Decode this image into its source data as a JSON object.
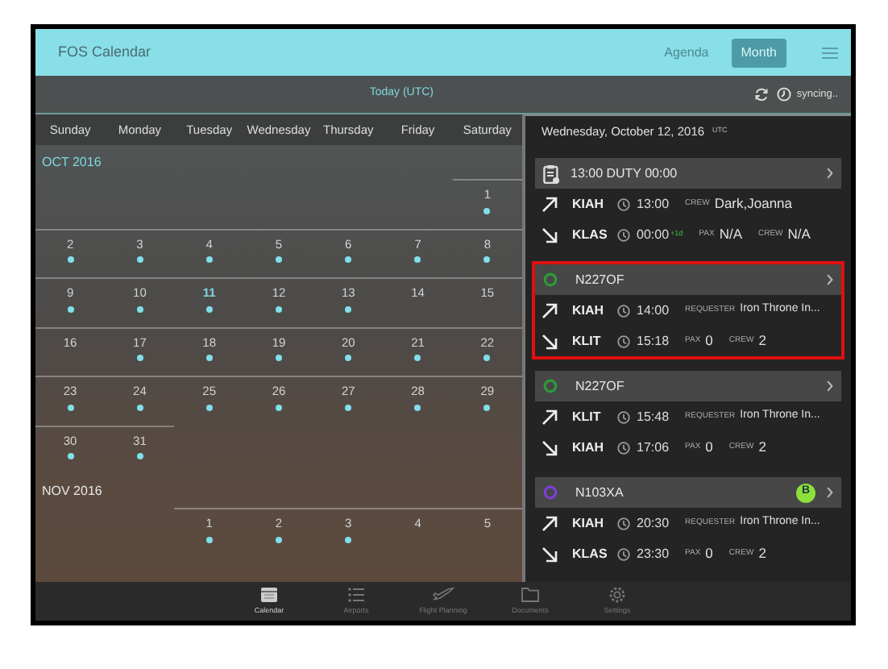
{
  "header": {
    "title": "FOS Calendar",
    "views": [
      {
        "label": "Agenda",
        "selected": false
      },
      {
        "label": "Month",
        "selected": true
      }
    ]
  },
  "subbar": {
    "today": "Today (UTC)",
    "sync_status": "syncing.."
  },
  "calendar": {
    "weekdays": [
      "Sunday",
      "Monday",
      "Tuesday",
      "Wednesday",
      "Thursday",
      "Friday",
      "Saturday"
    ],
    "months": [
      {
        "label": "OCT 2016",
        "weeks": [
          [
            {
              "kind": "blank"
            },
            {
              "kind": "blank"
            },
            {
              "kind": "blank"
            },
            {
              "kind": "blank"
            },
            {
              "kind": "blank"
            },
            {
              "kind": "blank"
            },
            {
              "day": "1",
              "events": true,
              "today": false
            }
          ],
          [
            {
              "day": "2",
              "events": true,
              "today": false
            },
            {
              "day": "3",
              "events": true,
              "today": false
            },
            {
              "day": "4",
              "events": true,
              "today": false
            },
            {
              "day": "5",
              "events": true,
              "today": false
            },
            {
              "day": "6",
              "events": true,
              "today": false
            },
            {
              "day": "7",
              "events": true,
              "today": false
            },
            {
              "day": "8",
              "events": true,
              "today": false
            }
          ],
          [
            {
              "day": "9",
              "events": true,
              "today": false
            },
            {
              "day": "10",
              "events": true,
              "today": false
            },
            {
              "day": "11",
              "events": true,
              "today": true
            },
            {
              "day": "12",
              "events": true,
              "today": false
            },
            {
              "day": "13",
              "events": true,
              "today": false
            },
            {
              "day": "14",
              "events": false,
              "today": false
            },
            {
              "day": "15",
              "events": false,
              "today": false
            }
          ],
          [
            {
              "day": "16",
              "events": false,
              "today": false
            },
            {
              "day": "17",
              "events": true,
              "today": false
            },
            {
              "day": "18",
              "events": true,
              "today": false
            },
            {
              "day": "19",
              "events": true,
              "today": false
            },
            {
              "day": "20",
              "events": true,
              "today": false
            },
            {
              "day": "21",
              "events": true,
              "today": false
            },
            {
              "day": "22",
              "events": true,
              "today": false
            }
          ],
          [
            {
              "day": "23",
              "events": true,
              "today": false
            },
            {
              "day": "24",
              "events": true,
              "today": false
            },
            {
              "day": "25",
              "events": true,
              "today": false
            },
            {
              "day": "26",
              "events": true,
              "today": false
            },
            {
              "day": "27",
              "events": true,
              "today": false
            },
            {
              "day": "28",
              "events": true,
              "today": false
            },
            {
              "day": "29",
              "events": true,
              "today": false
            }
          ],
          [
            {
              "day": "30",
              "events": true,
              "today": false
            },
            {
              "day": "31",
              "events": true,
              "today": false
            },
            {
              "kind": "blank"
            },
            {
              "kind": "blank"
            },
            {
              "kind": "blank"
            },
            {
              "kind": "blank"
            },
            {
              "kind": "blank"
            }
          ]
        ]
      },
      {
        "label": "NOV 2016",
        "weeks": [
          [
            {
              "kind": "blank"
            },
            {
              "kind": "blank"
            },
            {
              "day": "1",
              "events": true,
              "today": false
            },
            {
              "day": "2",
              "events": true,
              "today": false
            },
            {
              "day": "3",
              "events": true,
              "today": false
            },
            {
              "day": "4",
              "events": false,
              "today": false
            },
            {
              "day": "5",
              "events": false,
              "today": false
            }
          ]
        ]
      }
    ]
  },
  "day_panel": {
    "date": "Wednesday, October 12, 2016",
    "timezone": "UTC",
    "items": [
      {
        "kind": "duty",
        "title": "13:00 DUTY 00:00",
        "selected": false,
        "legs": [
          {
            "kind": "departure",
            "airport": "KIAH",
            "time": "13:00",
            "fields": [
              {
                "label": "CREW",
                "value": "Dark,Joanna"
              }
            ]
          },
          {
            "kind": "arrival",
            "airport": "KLAS",
            "time": "00:00",
            "day_offset": "+1d",
            "fields": [
              {
                "label": "PAX",
                "value": "N/A"
              },
              {
                "label": "CREW",
                "value": "N/A"
              }
            ]
          }
        ]
      },
      {
        "kind": "flight",
        "title": "N227OF",
        "color": "#2f9a3a",
        "selected": true,
        "legs": [
          {
            "kind": "departure",
            "airport": "KIAH",
            "time": "14:00",
            "fields": [
              {
                "label": "REQUESTER",
                "value": "Iron Throne In..."
              }
            ]
          },
          {
            "kind": "arrival",
            "airport": "KLIT",
            "time": "15:18",
            "fields": [
              {
                "label": "PAX",
                "value": "0"
              },
              {
                "label": "CREW",
                "value": "2"
              }
            ]
          }
        ]
      },
      {
        "kind": "flight",
        "title": "N227OF",
        "color": "#2f9a3a",
        "selected": false,
        "legs": [
          {
            "kind": "departure",
            "airport": "KLIT",
            "time": "15:48",
            "fields": [
              {
                "label": "REQUESTER",
                "value": "Iron Throne In..."
              }
            ]
          },
          {
            "kind": "arrival",
            "airport": "KIAH",
            "time": "17:06",
            "fields": [
              {
                "label": "PAX",
                "value": "0"
              },
              {
                "label": "CREW",
                "value": "2"
              }
            ]
          }
        ]
      },
      {
        "kind": "flight",
        "title": "N103XA",
        "color": "#7b3fd6",
        "selected": false,
        "badge": "B",
        "legs": [
          {
            "kind": "departure",
            "airport": "KIAH",
            "time": "20:30",
            "fields": [
              {
                "label": "REQUESTER",
                "value": "Iron Throne In..."
              }
            ]
          },
          {
            "kind": "arrival",
            "airport": "KLAS",
            "time": "23:30",
            "fields": [
              {
                "label": "PAX",
                "value": "0"
              },
              {
                "label": "CREW",
                "value": "2"
              }
            ]
          }
        ]
      }
    ]
  },
  "tab_bar": [
    {
      "kind": "calendar",
      "label": "Calendar",
      "selected": true
    },
    {
      "kind": "list",
      "label": "Airports",
      "selected": false
    },
    {
      "kind": "plane",
      "label": "Flight Planning",
      "selected": false
    },
    {
      "kind": "folder",
      "label": "Documents",
      "selected": false
    },
    {
      "kind": "gear",
      "label": "Settings",
      "selected": false
    }
  ]
}
